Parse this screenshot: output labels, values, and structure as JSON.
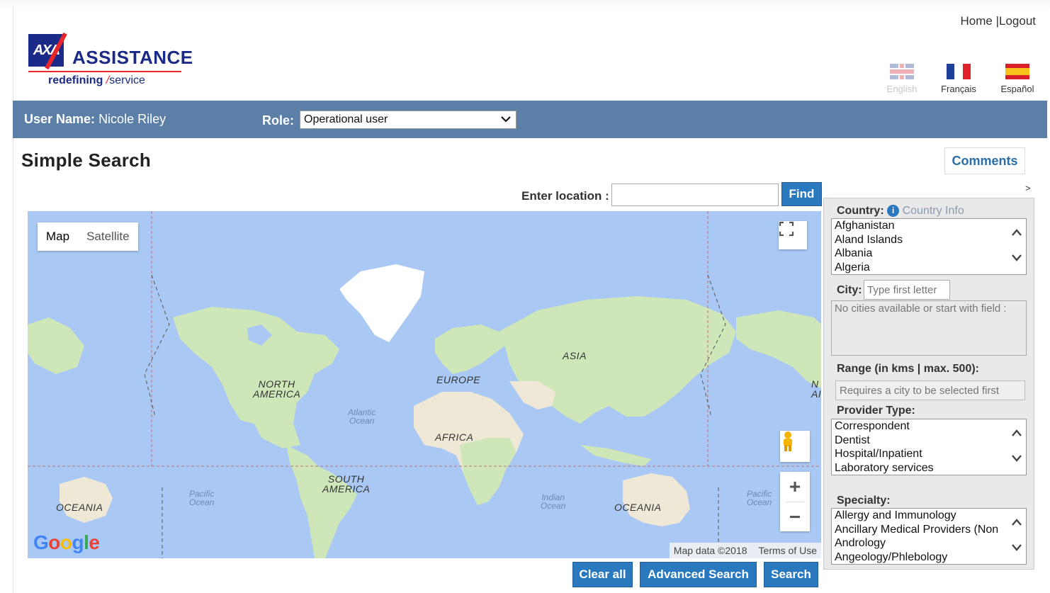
{
  "header": {
    "logo_word": "ASSISTANCE",
    "logo_box": "AXA",
    "tagline_bold": "redefining",
    "tagline_slash": "/",
    "tagline_rest": "service",
    "links": {
      "home": "Home",
      "sep": "|",
      "logout": "Logout"
    },
    "languages": [
      {
        "name": "English",
        "icon": "uk-flag-icon",
        "active": false
      },
      {
        "name": "Français",
        "icon": "france-flag-icon",
        "active": true
      },
      {
        "name": "Español",
        "icon": "spain-flag-icon",
        "active": true
      }
    ]
  },
  "userbar": {
    "user_label": "User Name:",
    "user_name": "Nicole Riley",
    "role_label": "Role:",
    "role_value": "Operational user"
  },
  "page": {
    "title": "Simple Search",
    "comments_label": "Comments",
    "collapse_symbol": ">"
  },
  "location": {
    "label": "Enter location :",
    "value": "",
    "find_label": "Find"
  },
  "map": {
    "toggle_map": "Map",
    "toggle_satellite": "Satellite",
    "google": "Google",
    "attribution": "Map data ©2018",
    "terms": "Terms of Use",
    "zoom_in": "+",
    "zoom_out": "−",
    "labels": {
      "north_america_1": "NORTH",
      "north_america_2": "AMERICA",
      "south_america_1": "SOUTH",
      "south_america_2": "AMERICA",
      "europe": "EUROPE",
      "africa": "AFRICA",
      "asia": "ASIA",
      "oceania_left": "OCEANIA",
      "oceania_right": "OCEANIA",
      "atlantic_1": "Atlantic",
      "atlantic_2": "Ocean",
      "pacific_left_1": "Pacific",
      "pacific_left_2": "Ocean",
      "pacific_right_1": "Pacific",
      "pacific_right_2": "Ocean",
      "indian_1": "Indian",
      "indian_2": "Ocean",
      "edge_na_1": "N",
      "edge_na_2": "AI"
    },
    "colors": {
      "water": "#a9c9f4",
      "land": "#cfe6b8",
      "desert": "#efe8d6",
      "ice": "#ffffff"
    }
  },
  "panel": {
    "country_label": "Country:",
    "country_info": "Country Info",
    "countries": [
      "Afghanistan",
      "Aland Islands",
      "Albania",
      "Algeria"
    ],
    "city_label": "City:",
    "city_placeholder": "Type first letter",
    "city_empty": "No cities available or start with field :",
    "range_label": "Range (in kms | max. 500):",
    "range_placeholder": "Requires a city to be selected first",
    "provider_label": "Provider Type:",
    "providers": [
      "Correspondent",
      "Dentist",
      "Hospital/Inpatient",
      "Laboratory services"
    ],
    "specialty_label": "Specialty:",
    "specialties": [
      "Allergy and Immunology",
      "Ancillary Medical Providers (Non",
      "Andrology",
      "Angeology/Phlebology"
    ]
  },
  "actions": {
    "clear_all": "Clear all",
    "advanced_search": "Advanced Search",
    "search": "Search"
  }
}
